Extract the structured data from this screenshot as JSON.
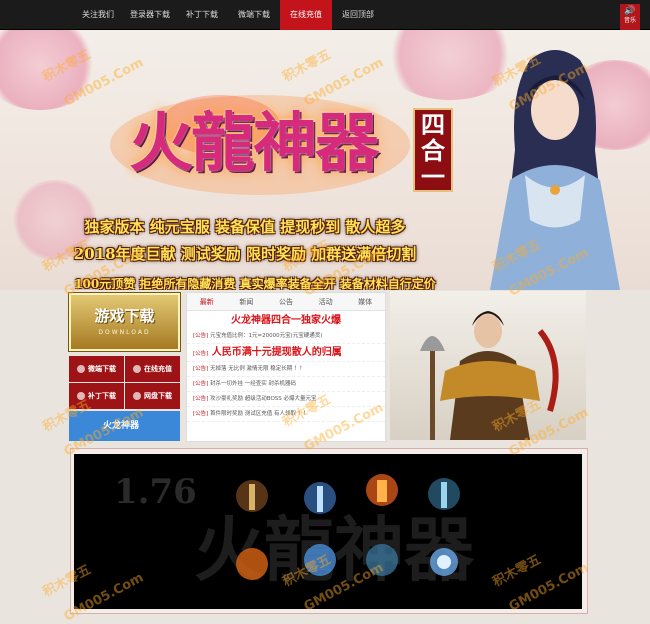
{
  "nav": {
    "items": [
      "关注我们",
      "登录器下载",
      "补丁下载",
      "微端下载",
      "在线充值",
      "返回顶部"
    ],
    "active_index": 4
  },
  "sound": {
    "label": "音乐",
    "icon": "speaker-icon"
  },
  "hero": {
    "logo_text": "火龍神器",
    "badge_text": "四合一",
    "slogan_1": "独家版本 纯元宝服 装备保值 提现秒到 散人超多",
    "slogan_2": "2018年度巨献 测试奖励 限时奖励 加群送满倍切割",
    "slogan_3": "100元顶赞 拒绝所有隐藏消费 真实爆率装备全开 装备材料自行定价"
  },
  "download": {
    "title": "游戏下载",
    "subtitle": "DOWNLOAD"
  },
  "quick_links": [
    "微端下载",
    "在线充值",
    "补丁下载",
    "网盘下载"
  ],
  "side_tab": "火龙神器",
  "news": {
    "tabs": [
      "最新",
      "新闻",
      "公告",
      "活动",
      "媒体"
    ],
    "headline": "火龙神器四合一独家火爆",
    "items": [
      {
        "tag": "[公告]",
        "text": "元宝充值比例：1元=20000元宝(元宝硬通货)",
        "big": false
      },
      {
        "tag": "[公告]",
        "text": "人民币满十元提现散人的归属",
        "big": true
      },
      {
        "tag": "[公告]",
        "text": "无掉落 无比例 激情无限 稳定长期 ！！",
        "big": false
      },
      {
        "tag": "[公告]",
        "text": "封杀一切外挂 一经查实 封杀机器码",
        "big": false
      },
      {
        "tag": "[公告]",
        "text": "攻沙豪礼奖励 超级活动BOSS 必爆大量元宝",
        "big": false
      },
      {
        "tag": "[公告]",
        "text": "首件限时奖励 测试区充值 有人领取 ！！",
        "big": false
      }
    ]
  },
  "showcase": {
    "version_label": "1.76"
  },
  "watermark": {
    "text_1": "积木零五",
    "text_2": "GM005.Com"
  },
  "colors": {
    "nav_active": "#c4141b",
    "accent_red": "#9e1316",
    "gold": "#ffe35a",
    "blue_tab": "#3b88d8"
  }
}
